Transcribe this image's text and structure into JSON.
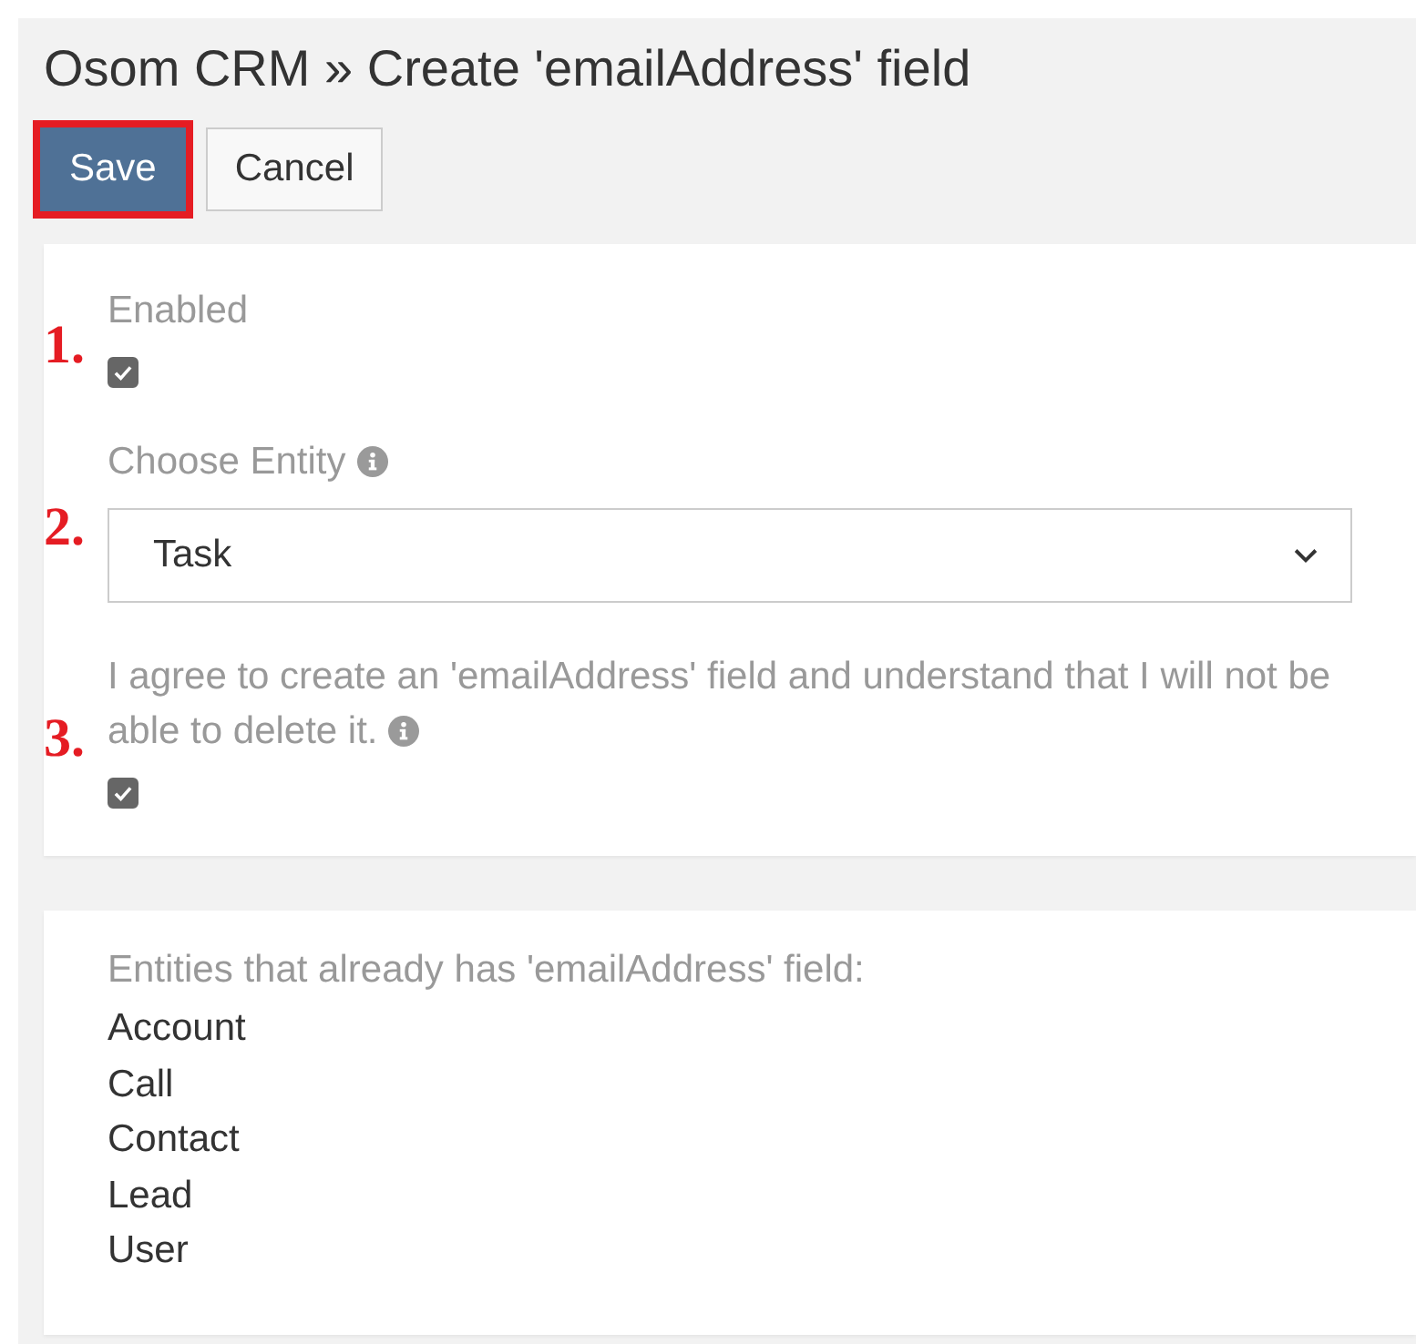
{
  "title": "Osom CRM » Create 'emailAddress' field",
  "buttons": [
    {
      "label": "Save",
      "kind": "primary",
      "highlighted": true
    },
    {
      "label": "Cancel",
      "kind": "default",
      "highlighted": false
    }
  ],
  "fields": [
    {
      "kind": "checkbox",
      "marker": "1.",
      "label": "Enabled",
      "info": false,
      "checked": true
    },
    {
      "kind": "select",
      "marker": "2.",
      "label": "Choose Entity",
      "info": true,
      "value": "Task"
    },
    {
      "kind": "checkbox",
      "marker": "3.",
      "label": "I agree to create an 'emailAddress' field and understand that I will not be able to delete it.",
      "info": true,
      "checked": true
    }
  ],
  "existing": {
    "heading": "Entities that already has 'emailAddress' field:",
    "items": [
      "Account",
      "Call",
      "Contact",
      "Lead",
      "User"
    ]
  }
}
